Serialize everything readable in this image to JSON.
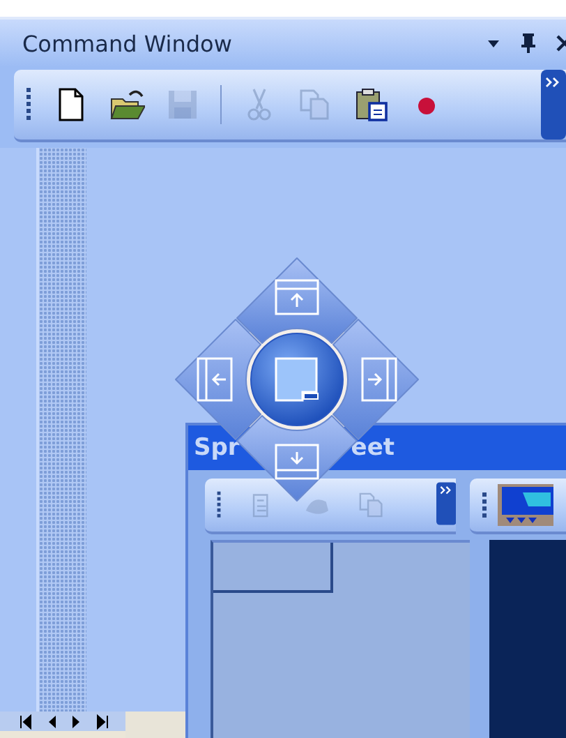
{
  "command_window": {
    "title": "Command Window",
    "toolbar": [
      {
        "kind": "new",
        "disabled": false
      },
      {
        "kind": "open",
        "disabled": false
      },
      {
        "kind": "save",
        "disabled": true
      },
      {
        "kind": "separator"
      },
      {
        "kind": "cut",
        "disabled": true
      },
      {
        "kind": "copy",
        "disabled": true
      },
      {
        "kind": "paste",
        "disabled": false
      },
      {
        "kind": "record",
        "disabled": false
      }
    ]
  },
  "spreadsheet": {
    "title_parts": [
      "Spr",
      "eet"
    ],
    "toolbar": [
      {
        "kind": "form",
        "disabled": true
      },
      {
        "kind": "chart",
        "disabled": true
      },
      {
        "kind": "copy",
        "disabled": true
      }
    ]
  }
}
